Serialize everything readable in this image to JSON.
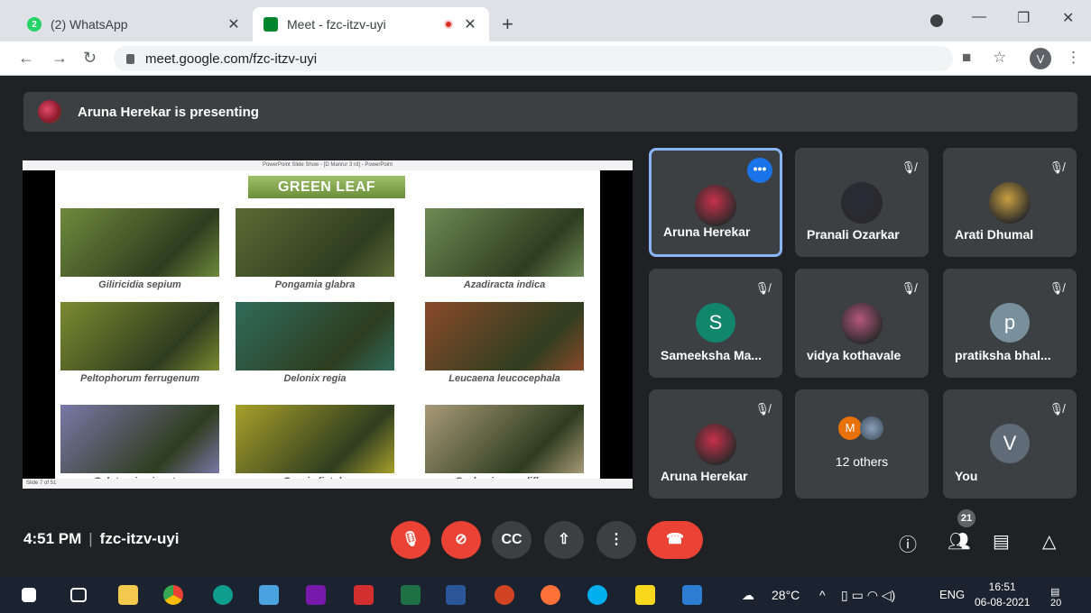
{
  "browser": {
    "tabs": [
      {
        "title": "(2) WhatsApp",
        "badge": "2"
      },
      {
        "title": "Meet - fzc-itzv-uyi"
      }
    ],
    "url": "meet.google.com/fzc-itzv-uyi",
    "profile_initial": "V"
  },
  "meet": {
    "presenting_banner": "Aruna Herekar is presenting",
    "slide": {
      "window_title": "PowerPoint Slide Show - [D Manrur 3 rd] - PowerPoint",
      "heading": "GREEN LEAF MANURE CROPS",
      "footer": "Slide 7 of 51",
      "crops": [
        {
          "caption": "Giliricidia sepium",
          "color": "#6f8a3c"
        },
        {
          "caption": "Pongamia glabra",
          "color": "#5b6b35"
        },
        {
          "caption": "Azadiracta indica",
          "color": "#6f8a55"
        },
        {
          "caption": "Peltophorum ferrugenum",
          "color": "#7c8a30"
        },
        {
          "caption": "Delonix regia",
          "color": "#2f6b5a"
        },
        {
          "caption": "Leucaena leucocephala",
          "color": "#8a4a2a"
        },
        {
          "caption": "Calotropis gigantea",
          "color": "#7a78a8"
        },
        {
          "caption": "Cassia fistula",
          "color": "#a8a02a"
        },
        {
          "caption": "Sesbania grandiflora",
          "color": "#a89a78"
        }
      ]
    },
    "participants": [
      {
        "name": "Aruna Herekar",
        "type": "photo",
        "color": "#c8304a"
      },
      {
        "name": "Pranali Ozarkar",
        "type": "photo",
        "color": "#2a2a3a"
      },
      {
        "name": "Arati Dhumal",
        "type": "photo",
        "color": "#c9a040"
      },
      {
        "name": "Sameeksha Ma...",
        "type": "letter",
        "letter": "S",
        "color": "#12866d"
      },
      {
        "name": "vidya kothavale",
        "type": "photo",
        "color": "#b5587a"
      },
      {
        "name": "pratiksha bhal...",
        "type": "letter",
        "letter": "p",
        "color": "#78909c"
      },
      {
        "name": "Aruna Herekar",
        "type": "photo",
        "color": "#c8304a"
      },
      {
        "name": "12 others",
        "type": "others",
        "mini_letter": "M"
      },
      {
        "name": "You",
        "type": "letter",
        "letter": "V",
        "color": "#5f6b76"
      }
    ],
    "bottom": {
      "time": "4:51 PM",
      "meeting_code": "fzc-itzv-uyi",
      "people_count": "21"
    }
  },
  "taskbar": {
    "weather": "28°C",
    "language": "ENG",
    "time": "16:51",
    "date": "06-08-2021",
    "notifications": "20"
  }
}
